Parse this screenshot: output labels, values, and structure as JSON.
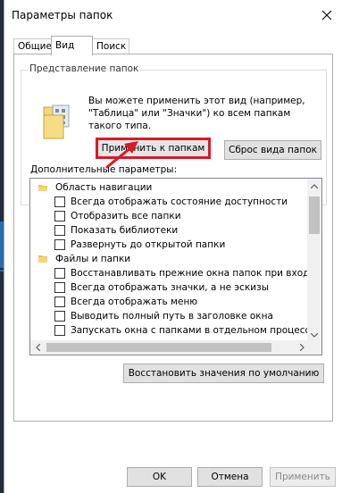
{
  "window": {
    "title": "Параметры папок",
    "close_glyph": "✕"
  },
  "tabs": [
    {
      "label": "Общие",
      "active": false
    },
    {
      "label": "Вид",
      "active": true
    },
    {
      "label": "Поиск",
      "active": false
    }
  ],
  "folder_view": {
    "group_title": "Представление папок",
    "description": "Вы можете применить этот вид (например, \"Таблица\" или \"Значки\") ко всем папкам такого типа.",
    "apply_button": "Применить к папкам",
    "reset_button": "Сброс вида папок",
    "highlight_color": "#d81b26"
  },
  "advanced": {
    "label": "Дополнительные параметры:",
    "items": [
      {
        "type": "category",
        "label": "Область навигации",
        "icon": "navigation-pane-icon"
      },
      {
        "type": "checkbox",
        "label": "Всегда отображать состояние доступности",
        "checked": false
      },
      {
        "type": "checkbox",
        "label": "Отобразить все папки",
        "checked": false
      },
      {
        "type": "checkbox",
        "label": "Показать библиотеки",
        "checked": false
      },
      {
        "type": "checkbox",
        "label": "Развернуть до открытой папки",
        "checked": false
      },
      {
        "type": "category",
        "label": "Файлы и папки",
        "icon": "folder-icon"
      },
      {
        "type": "checkbox",
        "label": "Восстанавливать прежние окна папок при входе в си",
        "checked": false
      },
      {
        "type": "checkbox",
        "label": "Всегда отображать значки, а не эскизы",
        "checked": false
      },
      {
        "type": "checkbox",
        "label": "Всегда отображать меню",
        "checked": false
      },
      {
        "type": "checkbox",
        "label": "Выводить полный путь в заголовке окна",
        "checked": false
      },
      {
        "type": "checkbox",
        "label": "Запускать окна с папками в отдельном процессе",
        "checked": false
      }
    ],
    "restore_defaults_button": "Восстановить значения по умолчанию"
  },
  "footer": {
    "ok": "OK",
    "cancel": "Отмена",
    "apply": "Применить"
  }
}
